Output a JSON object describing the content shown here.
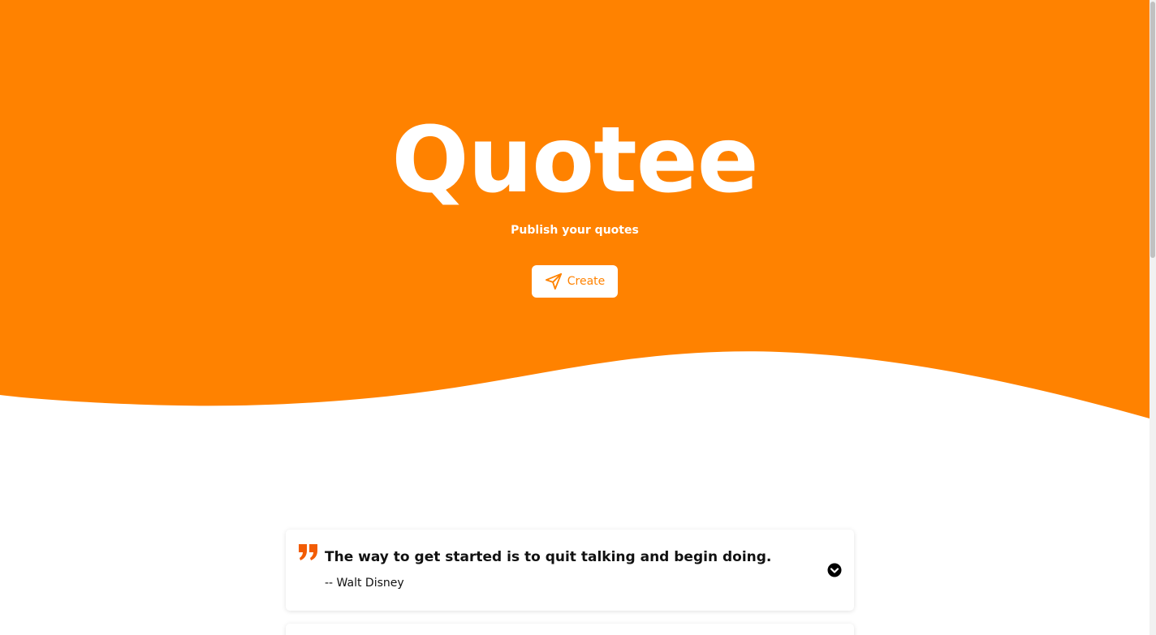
{
  "colors": {
    "brand": "#FF8200",
    "quote_mark": "#F25C05",
    "white": "#FFFFFF"
  },
  "hero": {
    "title": "Quotee",
    "subtitle": "Publish your quotes",
    "create_button": {
      "label": "Create",
      "icon": "send-icon"
    }
  },
  "quotes": [
    {
      "text": "The way to get started is to quit talking and begin doing.",
      "author": "-- Walt Disney",
      "mark_icon": "quote-mark-icon",
      "toggle_icon": "chevron-down-circle-icon"
    }
  ]
}
